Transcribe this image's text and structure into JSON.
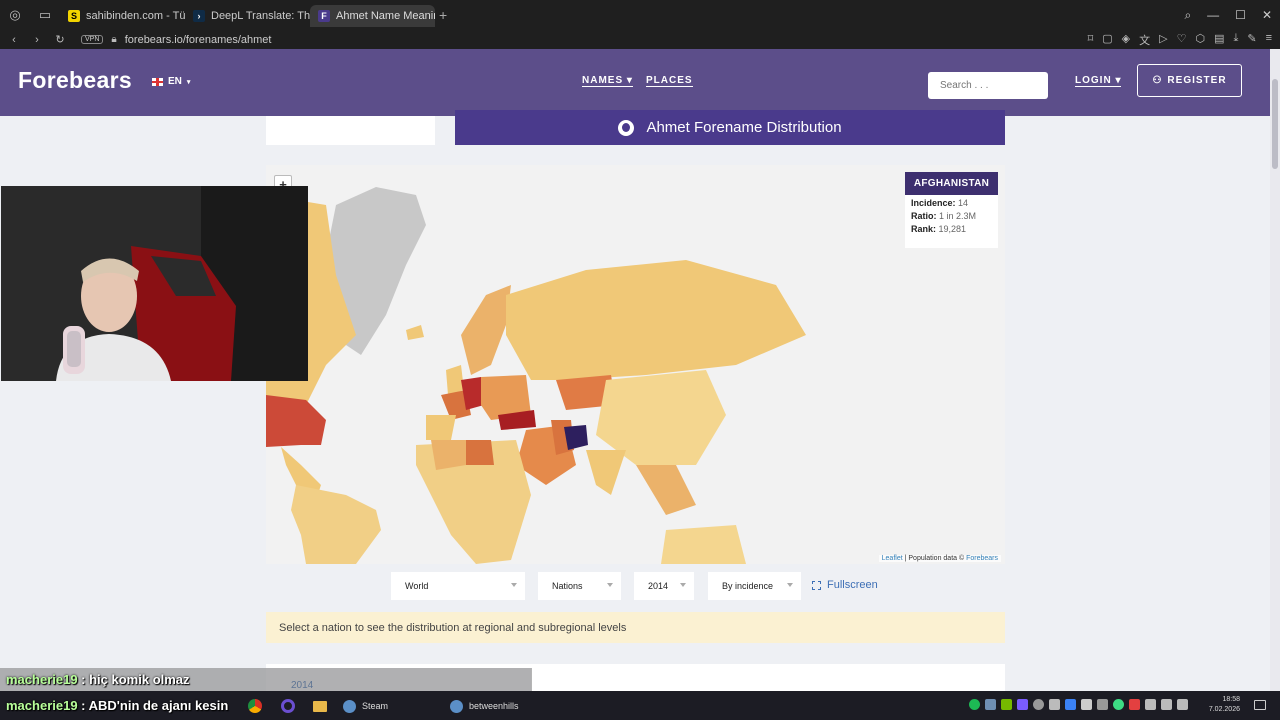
{
  "browser": {
    "tabs": [
      {
        "title": "sahibinden.com - Türkiye'r",
        "favicon": "S",
        "favicon_color": "#f2d400"
      },
      {
        "title": "DeepL Translate: The wor",
        "favicon": "›",
        "favicon_color": "#0f2b46"
      },
      {
        "title": "Ahmet Name Meaning, Or",
        "favicon": "F",
        "favicon_color": "#4a3a8c"
      }
    ],
    "url": "forebears.io/forenames/ahmet",
    "vpn_label": "VPN"
  },
  "header": {
    "logo": "Forebears",
    "lang": "EN",
    "nav_names": "NAMES",
    "nav_places": "PLACES",
    "search_placeholder": "Search . . .",
    "login": "LOGIN",
    "register": "REGISTER"
  },
  "banner": {
    "title": "Ahmet Forename Distribution"
  },
  "map": {
    "zoom_in": "+",
    "info": {
      "country": "AFGHANISTAN",
      "incidence_label": "Incidence:",
      "incidence_value": "14",
      "ratio_label": "Ratio:",
      "ratio_value": "1 in 2.3M",
      "rank_label": "Rank:",
      "rank_value": "19,281"
    },
    "attribution_leaflet": "Leaflet",
    "attribution_text": " | Population data © ",
    "attribution_forebears": "Forebears"
  },
  "controls": {
    "region": "World",
    "level": "Nations",
    "year": "2014",
    "measure": "By incidence",
    "fullscreen": "Fullscreen"
  },
  "notice": "Select a nation to see the distribution at regional and subregional levels",
  "bottom_tab": "2014",
  "chat": [
    {
      "user": "macherie19",
      "message": " : hiç komik olmaz"
    },
    {
      "user": "macherie19",
      "message": " : ABD'nin de ajanı kesin"
    }
  ],
  "taskbar": {
    "steam": "Steam",
    "betweenhills": "betweenhills",
    "time": "18:58",
    "date": "7.02.2026"
  }
}
